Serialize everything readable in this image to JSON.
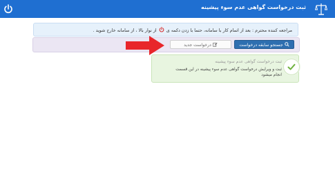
{
  "header": {
    "title": "ثبت درخواست گواهی عدم سوء پیشینه"
  },
  "notice": {
    "part1": "مراجعه کننده محترم : بعد از اتمام کار با سامانه، حتما با زدن دکمه ی",
    "part2": "از نوار بالا ، از سامانه خارج شوید ."
  },
  "toolbar": {
    "search_label": "جستجو سابقه درخواست",
    "new_label": "درخواست جدید"
  },
  "alert": {
    "heading": "ثبت درخواست گواهی عدم سوء پیشینه",
    "message": "ثبت و ویرایش درخواست گواهی عدم سوء پیشینه در این قسمت انجام میشود"
  },
  "colors": {
    "header_bg": "#1f6fd1",
    "primary_button": "#2e6fb0",
    "alert_bg": "#e8f5e0",
    "arrow": "#e8262b"
  },
  "icons": {
    "header_left": "power-icon",
    "header_right": "scales-of-justice-icon",
    "notice": "power-icon",
    "search_button": "search-icon",
    "new_button": "edit-icon",
    "alert": "check-icon",
    "pointer": "arrow-right-icon"
  }
}
